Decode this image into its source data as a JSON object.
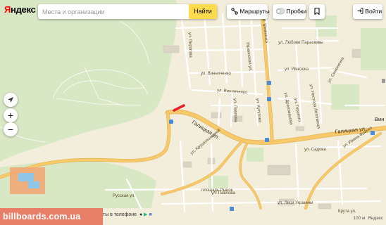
{
  "header": {
    "logo_first": "Я",
    "logo_rest": "ндекс",
    "search_placeholder": "Места и организации",
    "search_value": "",
    "find_label": "Найти",
    "routes_label": "Маршруты",
    "traffic_label": "Пробки",
    "login_label": "Войти"
  },
  "controls": {
    "locate": "locate-arrow-icon",
    "zoom_in": "+",
    "zoom_out": "−"
  },
  "map": {
    "streets": {
      "galitskaya_1": "Галицкая ул.",
      "galitskaya_2": "Галицкая ул.",
      "russkaya": "Русская ул.",
      "vinnichenko_1": "ул. Винниченко",
      "vinnichenko_2": "ул. Винниченко",
      "ivano_franko": "ул. Ивана Франко",
      "sadova": "ул. Садова",
      "lesi_ukrainki": "ул. Леси Украинки",
      "kruta": "Крута ул.",
      "pavlova": "ул. Павлова",
      "pavlova_lower": "ул. Павлова",
      "rynok": "площадь Рынок",
      "pirogova": "ул. Пирогова",
      "lyubov_paraskevy": "ул. Любови Параскевы",
      "ivasyuk": "ул. Ивасюка",
      "gorkogo": "ул. Горького",
      "nestora": "ул. Нестора Летописца",
      "shevchenko": "ул. Шевченко",
      "drahomanova": "ул. Драгоманова",
      "kutuzova": "ул. Кутузова",
      "ukrainskaya": "Украинская ул.",
      "simonenka": "ул. Симоненка",
      "krushelnitskoy": "ул. Крушельницкой"
    },
    "place_vin": "Вин"
  },
  "watermark": "billboards.com.ua",
  "promo": "ты в телефоне",
  "footer": {
    "scale": "100 м",
    "brand": "Яндекс"
  },
  "colors": {
    "land": "#f3eedc",
    "forest": "#d9e8c4",
    "major_road": "#f7c96b",
    "road": "#ffffff",
    "building": "#d9d4c4",
    "highlight": "#e8202a",
    "find_button": "#ffdb4d",
    "logo_red": "#ff0000"
  }
}
